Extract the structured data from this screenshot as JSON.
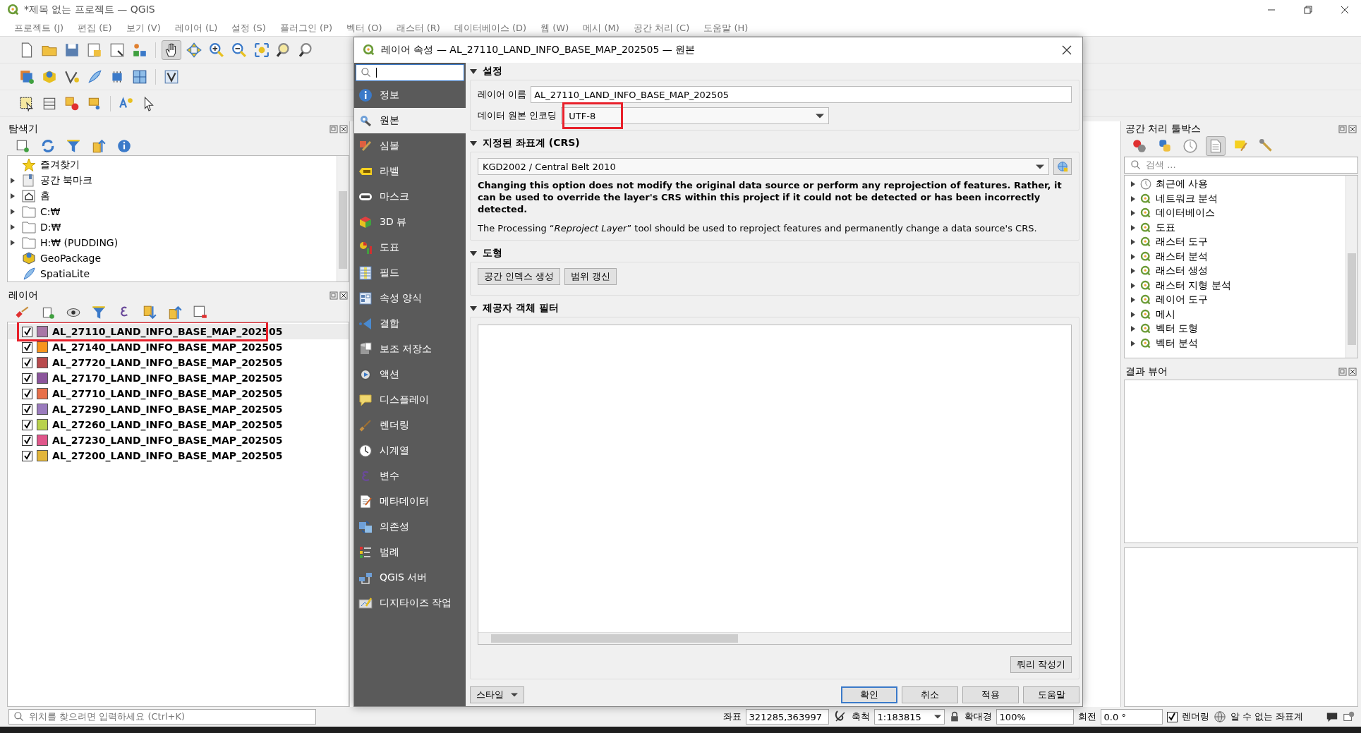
{
  "window": {
    "title": "*제목 없는 프로젝트 — QGIS"
  },
  "menu": [
    "프로젝트 (J)",
    "편집 (E)",
    "보기 (V)",
    "레이어 (L)",
    "설정 (S)",
    "플러그인 (P)",
    "벡터 (O)",
    "래스터 (R)",
    "데이터베이스 (D)",
    "웹 (W)",
    "메시 (M)",
    "공간 처리 (C)",
    "도움말 (H)"
  ],
  "browser": {
    "title": "탐색기",
    "items": [
      {
        "label": "즐겨찾기",
        "collapsible": false
      },
      {
        "label": "공간 북마크",
        "collapsible": true
      },
      {
        "label": "홈",
        "collapsible": true
      },
      {
        "label": "C:₩",
        "collapsible": true
      },
      {
        "label": "D:₩",
        "collapsible": true
      },
      {
        "label": "H:₩ (PUDDING)",
        "collapsible": true
      },
      {
        "label": "GeoPackage",
        "collapsible": false
      },
      {
        "label": "SpatiaLite",
        "collapsible": false
      }
    ]
  },
  "layers": {
    "title": "레이어",
    "items": [
      {
        "label": "AL_27110_LAND_INFO_BASE_MAP_202505",
        "checked": true,
        "color": "#a877a6",
        "selected": true,
        "highlighted": true
      },
      {
        "label": "AL_27140_LAND_INFO_BASE_MAP_202505",
        "checked": true,
        "color": "#f7941d",
        "selected": false,
        "highlighted": false
      },
      {
        "label": "AL_27720_LAND_INFO_BASE_MAP_202505",
        "checked": true,
        "color": "#b84a4d",
        "selected": false,
        "highlighted": false
      },
      {
        "label": "AL_27170_LAND_INFO_BASE_MAP_202505",
        "checked": true,
        "color": "#8b559b",
        "selected": false,
        "highlighted": false
      },
      {
        "label": "AL_27710_LAND_INFO_BASE_MAP_202505",
        "checked": true,
        "color": "#e8704a",
        "selected": false,
        "highlighted": false
      },
      {
        "label": "AL_27290_LAND_INFO_BASE_MAP_202505",
        "checked": true,
        "color": "#9a7bbd",
        "selected": false,
        "highlighted": false
      },
      {
        "label": "AL_27260_LAND_INFO_BASE_MAP_202505",
        "checked": true,
        "color": "#b9d24c",
        "selected": false,
        "highlighted": false
      },
      {
        "label": "AL_27230_LAND_INFO_BASE_MAP_202505",
        "checked": true,
        "color": "#e0568a",
        "selected": false,
        "highlighted": false
      },
      {
        "label": "AL_27200_LAND_INFO_BASE_MAP_202505",
        "checked": true,
        "color": "#e2b53a",
        "selected": false,
        "highlighted": false
      }
    ]
  },
  "dialog": {
    "title": "레이어 속성 — AL_27110_LAND_INFO_BASE_MAP_202505 — 원본",
    "nav": [
      {
        "label": "정보",
        "selected": false
      },
      {
        "label": "원본",
        "selected": true
      },
      {
        "label": "심볼",
        "selected": false
      },
      {
        "label": "라벨",
        "selected": false
      },
      {
        "label": "마스크",
        "selected": false
      },
      {
        "label": "3D 뷰",
        "selected": false
      },
      {
        "label": "도표",
        "selected": false
      },
      {
        "label": "필드",
        "selected": false
      },
      {
        "label": "속성 양식",
        "selected": false
      },
      {
        "label": "결합",
        "selected": false
      },
      {
        "label": "보조 저장소",
        "selected": false
      },
      {
        "label": "액션",
        "selected": false
      },
      {
        "label": "디스플레이",
        "selected": false
      },
      {
        "label": "렌더링",
        "selected": false
      },
      {
        "label": "시계열",
        "selected": false
      },
      {
        "label": "변수",
        "selected": false
      },
      {
        "label": "메타데이터",
        "selected": false
      },
      {
        "label": "의존성",
        "selected": false
      },
      {
        "label": "범례",
        "selected": false
      },
      {
        "label": "QGIS 서버",
        "selected": false
      },
      {
        "label": "디지타이즈 작업",
        "selected": false
      }
    ],
    "settings": {
      "header": "설정",
      "layer_name_label": "레이어 이름",
      "layer_name": "AL_27110_LAND_INFO_BASE_MAP_202505",
      "encoding_label": "데이터 원본 인코딩",
      "encoding": "UTF-8",
      "encoding_highlighted": true
    },
    "crs": {
      "header": "지정된 좌표계 (CRS)",
      "value": "KGD2002 / Central Belt 2010",
      "warning": "Changing this option does not modify the original data source or perform any reprojection of features. Rather, it can be used to override the layer's CRS within this project if it could not be detected or has been incorrectly detected.",
      "note": "The Processing “*Reproject Layer*” tool should be used to reproject features and permanently change a data source's CRS."
    },
    "geometry": {
      "header": "도형",
      "buttons": [
        "공간 인덱스 생성",
        "범위 갱신"
      ]
    },
    "filter": {
      "header": "제공자 객체 필터",
      "query_button": "쿼리 작성기"
    },
    "style_button": "스타일",
    "buttons": [
      {
        "label": "확인",
        "default": true
      },
      {
        "label": "취소",
        "default": false
      },
      {
        "label": "적용",
        "default": false
      },
      {
        "label": "도움말",
        "default": false
      }
    ]
  },
  "toolbox": {
    "title": "공간 처리 툴박스",
    "search_placeholder": "검색 ...",
    "items": [
      "최근에 사용",
      "네트워크 분석",
      "데이터베이스",
      "도표",
      "래스터 도구",
      "래스터 분석",
      "래스터 생성",
      "래스터 지형 분석",
      "레이어 도구",
      "메시",
      "벡터 도형",
      "벡터 분석"
    ]
  },
  "results": {
    "title": "결과 뷰어"
  },
  "status_bar": {
    "locator_placeholder": "위치를 찾으려면 입력하세요 (Ctrl+K)",
    "coordinate_label": "좌표",
    "coordinate": "321285,363997",
    "scale_label": "축척",
    "scale": "1:183815",
    "magnifier_label": "확대경",
    "magnifier": "100%",
    "rotation_label": "회전",
    "rotation": "0.0 °",
    "render_label": "렌더링",
    "render_checked": true,
    "crs": "알 수 없는 좌표계"
  }
}
